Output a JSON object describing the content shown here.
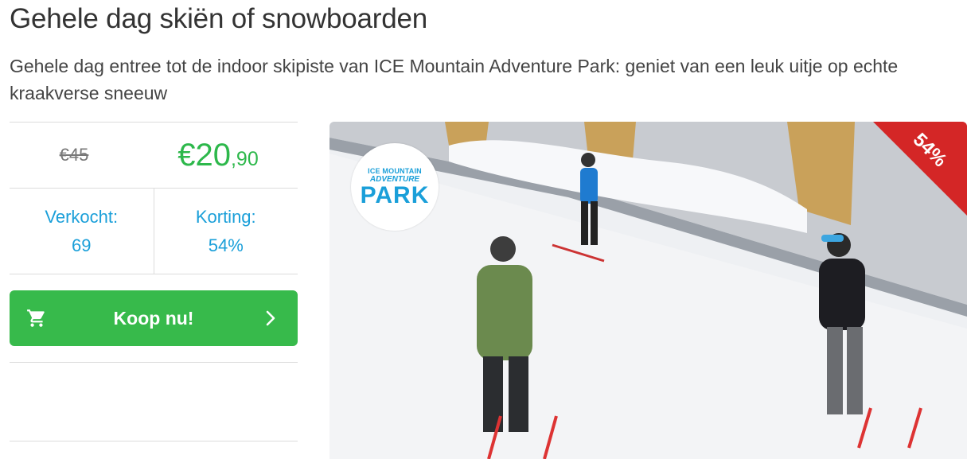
{
  "title": "Gehele dag skiën of snowboarden",
  "subtitle": "Gehele dag entree tot de indoor skipiste van ICE Mountain Adventure Park: geniet van een leuk uitje op echte kraakverse sneeuw",
  "price": {
    "old": "€45",
    "new_main": "€20",
    "new_cents": ",90"
  },
  "stats": {
    "sold_label": "Verkocht:",
    "sold_value": "69",
    "discount_label": "Korting:",
    "discount_value": "54%"
  },
  "buy_button": {
    "label": "Koop nu!",
    "icon": "shopping-cart-icon",
    "chevron": "chevron-right-icon"
  },
  "photo": {
    "badge": "54%",
    "logo_line1": "ICE MOUNTAIN",
    "logo_line2": "ADVENTURE",
    "logo_line3": "PARK"
  },
  "colors": {
    "accent_green": "#37ba4b",
    "price_green": "#2db84b",
    "stat_blue": "#1a9fd9",
    "badge_red": "#d42626"
  }
}
